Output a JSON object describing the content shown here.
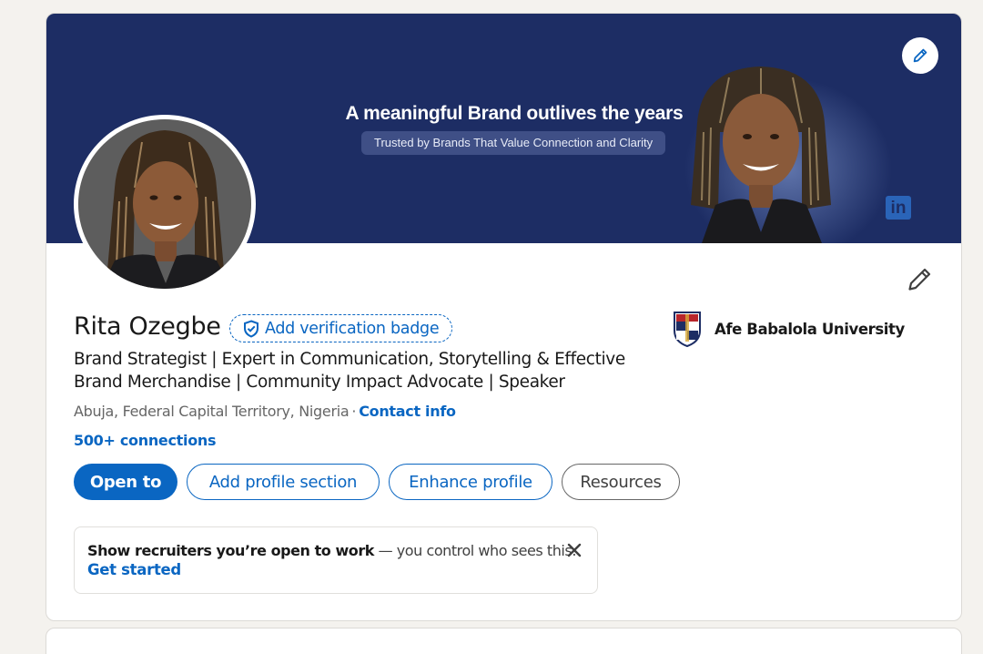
{
  "banner": {
    "headline": "A meaningful Brand outlives the years",
    "subheadline": "Trusted by Brands That Value Connection and Clarity",
    "logo_text": "in",
    "edit_icon": "pencil-icon"
  },
  "profile": {
    "name": "Rita Ozegbe",
    "verification_label": "Add verification badge",
    "headline": "Brand Strategist | Expert in Communication, Storytelling & Effective Brand Merchandise | Community Impact Advocate | Speaker",
    "location": "Abuja, Federal Capital Territory, Nigeria",
    "separator": "·",
    "contact_info_label": "Contact info",
    "connections_label": "500+ connections",
    "edit_icon": "pencil-icon"
  },
  "education": {
    "school_name": "Afe Babalola University",
    "logo_icon": "university-crest-icon"
  },
  "actions": {
    "open_to_label": "Open to",
    "add_section_label": "Add profile section",
    "enhance_label": "Enhance profile",
    "resources_label": "Resources"
  },
  "open_to_work": {
    "bold_text": "Show recruiters you’re open to work",
    "rest_text": " — you control who sees this.",
    "cta_label": "Get started",
    "close_icon": "close-icon"
  },
  "colors": {
    "primary": "#0a66c2",
    "banner_bg": "#1d2d64",
    "page_bg": "#f4f2ee"
  }
}
